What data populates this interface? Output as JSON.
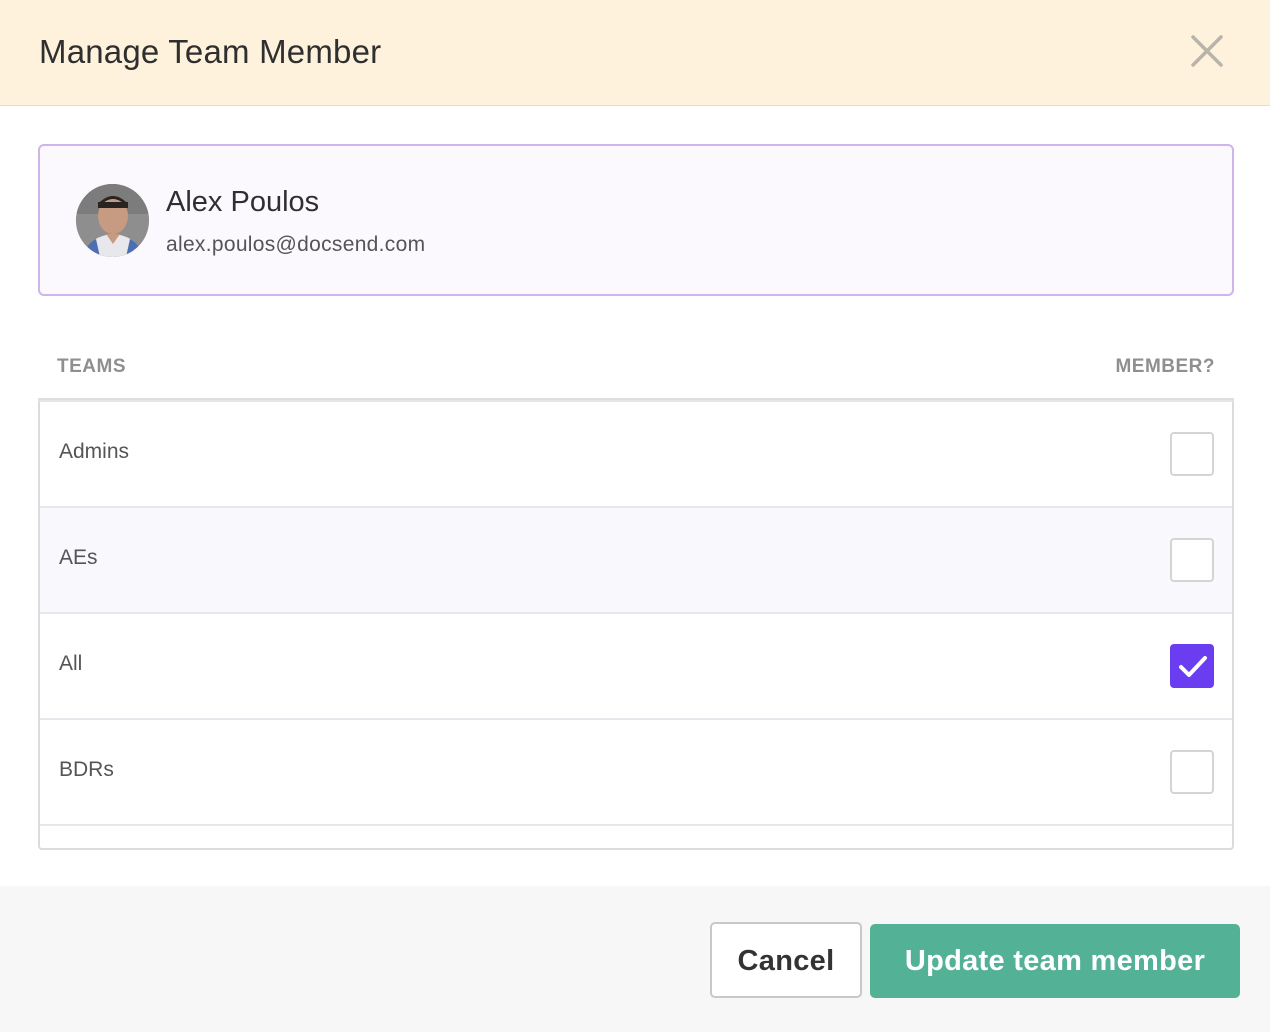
{
  "modal": {
    "title": "Manage Team Member",
    "close_icon": "close-icon"
  },
  "user": {
    "name": "Alex Poulos",
    "email": "alex.poulos@docsend.com",
    "avatar_icon": "avatar-photo"
  },
  "table": {
    "col_teams": "TEAMS",
    "col_member": "MEMBER?",
    "rows": [
      {
        "label": "Admins",
        "checked": false
      },
      {
        "label": "AEs",
        "checked": false
      },
      {
        "label": "All",
        "checked": true
      },
      {
        "label": "BDRs",
        "checked": false
      }
    ]
  },
  "footer": {
    "cancel_label": "Cancel",
    "update_label": "Update team member"
  },
  "colors": {
    "header_bg": "#fef2dc",
    "accent_purple": "#6a3df0",
    "primary_green": "#53b195",
    "card_border": "#cfb5ec"
  }
}
